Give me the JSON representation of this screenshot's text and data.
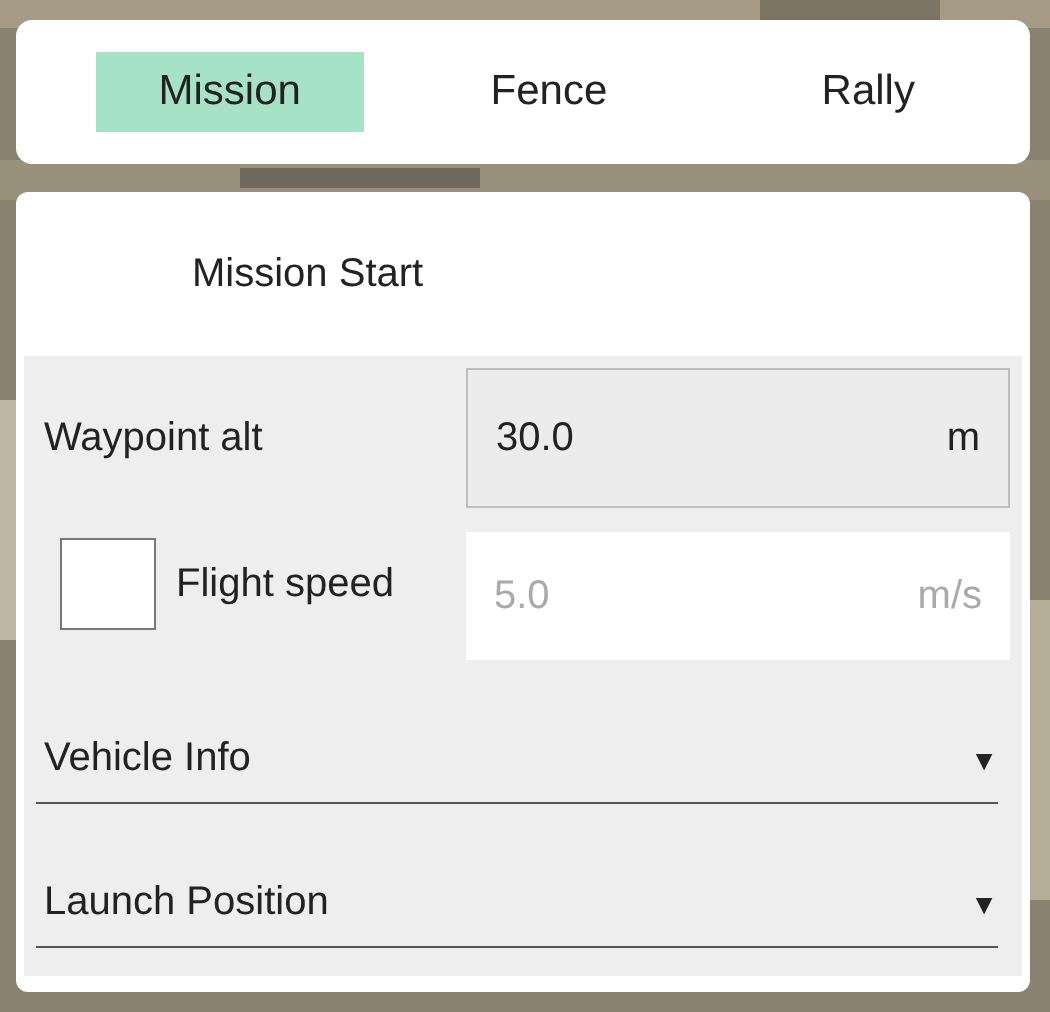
{
  "tabs": [
    {
      "label": "Mission",
      "selected": true
    },
    {
      "label": "Fence",
      "selected": false
    },
    {
      "label": "Rally",
      "selected": false
    }
  ],
  "section_title": "Mission Start",
  "waypoint_alt": {
    "label": "Waypoint alt",
    "value": "30.0",
    "unit": "m"
  },
  "flight_speed": {
    "label": "Flight speed",
    "checked": false,
    "placeholder": "5.0",
    "unit": "m/s"
  },
  "dropdowns": [
    {
      "label": "Vehicle Info",
      "caret": "▼"
    },
    {
      "label": "Launch Position",
      "caret": "▼"
    }
  ]
}
